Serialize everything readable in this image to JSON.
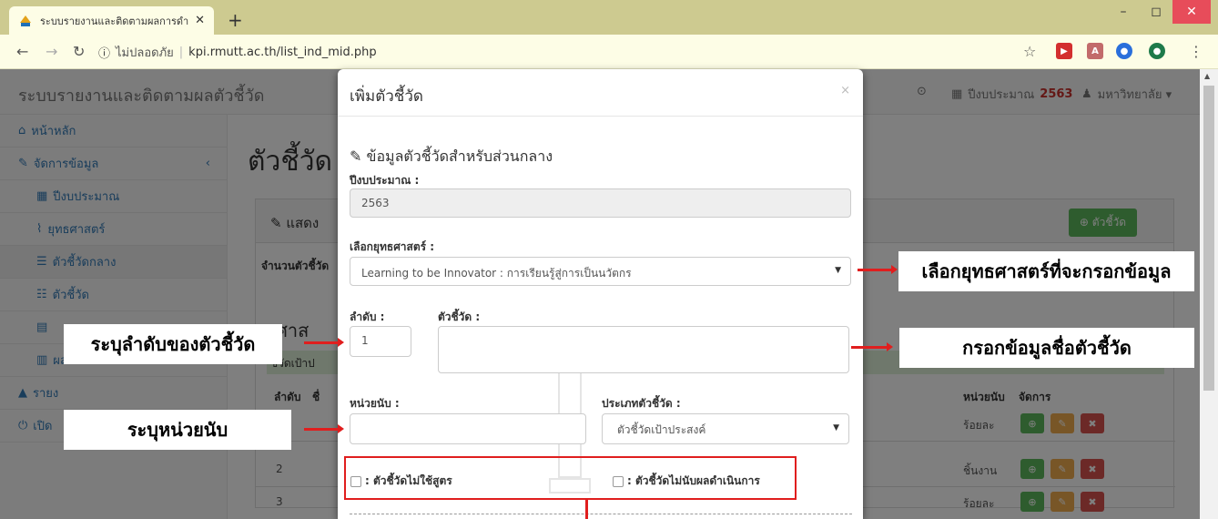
{
  "browser": {
    "tab_title": "ระบบรายงานและติดตามผลการดำเนินง",
    "new_tab": "+",
    "url_insecure": "ไม่ปลอดภัย",
    "url": "kpi.rmutt.ac.th/list_ind_mid.php",
    "minimize": "–",
    "maximize": "◻",
    "close": "✕"
  },
  "app": {
    "brand": "ระบบรายงานและติดตามผลตัวชี้วัด",
    "fiscal_label": "ปีงบประมาณ",
    "fiscal_value": "2563",
    "user": "มหาวิทยาลัย ▾"
  },
  "sidebar": {
    "items": [
      {
        "label": "หน้าหลัก"
      },
      {
        "label": "จัดการข้อมูล"
      },
      {
        "label": "ปีงบประมาณ"
      },
      {
        "label": "ยุทธศาสตร์"
      },
      {
        "label": "ตัวชี้วัดกลาง"
      },
      {
        "label": "ตัวชี้วัด"
      },
      {
        "label": ""
      },
      {
        "label": "ผลการดำเนินการ"
      },
      {
        "label": "รายง"
      },
      {
        "label": "เปิด"
      }
    ]
  },
  "main": {
    "page_title": "ตัวชี้วัด",
    "panel_head": "แสดง",
    "add_button": "ตัวชี้วัด",
    "count_label": "จำนวนตัวชี้วัด",
    "strategy_heading": "ธศาส",
    "target_row": "ชี้วัดเป้าป",
    "col_order": "ลำดับ",
    "col_name": "ชื่",
    "col_unit": "หน่วยนับ",
    "col_manage": "จัดการ",
    "rows": [
      {
        "order": "",
        "unit": "ร้อยละ"
      },
      {
        "order": "2",
        "unit": "ชิ้นงาน"
      },
      {
        "order": "3",
        "unit": "ร้อยละ"
      }
    ]
  },
  "modal": {
    "title": "เพิ่มตัวชี้วัด",
    "close": "×",
    "section": "ข้อมูลตัวชี้วัดสำหรับส่วนกลาง",
    "fiscal_label": "ปีงบประมาณ :",
    "fiscal_value": "2563",
    "strategy_label": "เลือกยุทธศาสตร์ :",
    "strategy_value": "Learning to be Innovator : การเรียนรู้สู่การเป็นนวัตกร",
    "order_label": "ลำดับ :",
    "order_value": "1",
    "name_label": "ตัวชี้วัด :",
    "unit_label": "หน่วยนับ :",
    "type_label": "ประเภทตัวชี้วัด :",
    "type_value": "ตัวชี้วัดเป้าประสงค์",
    "chk_noformula": ": ตัวชี้วัดไม่ใช้สูตร",
    "chk_nocount": ": ตัวชี้วัดไม่นับผลดำเนินการ"
  },
  "callouts": {
    "strategy": "เลือกยุทธศาสตร์ที่จะกรอกข้อมูล",
    "name": "กรอกข้อมูลชื่อตัวชี้วัด",
    "order": "ระบุลำดับของตัวชี้วัด",
    "unit": "ระบุหน่วยนับ"
  },
  "colors": {
    "accent_red": "#e01e1e",
    "success": "#5cb85c",
    "warning": "#f0ad4e",
    "danger": "#d9534f",
    "link": "#337ab7"
  }
}
